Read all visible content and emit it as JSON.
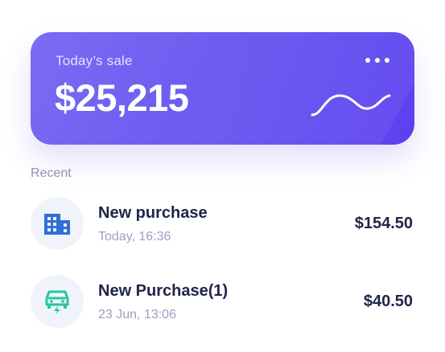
{
  "sale_card": {
    "label": "Today’s sale",
    "amount": "$25,215",
    "menu_icon": "more-horizontal-icon",
    "trend_icon": "wave-trend-icon",
    "gradient_start": "#7b6cf3",
    "gradient_end": "#5b3ff0"
  },
  "recent": {
    "label": "Recent",
    "transactions": [
      {
        "title": "New purchase",
        "time": "Today, 16:36",
        "amount": "$154.50",
        "icon": "building-icon",
        "icon_color": "#2f6fd8"
      },
      {
        "title": "New Purchase(1)",
        "time": "23 Jun, 13:06",
        "amount": "$40.50",
        "icon": "car-charging-icon",
        "icon_color": "#22c9a0"
      }
    ]
  },
  "colors": {
    "text_primary": "#20254a",
    "text_secondary": "#9aa0c1",
    "avatar_bg": "#f1f3fa"
  }
}
